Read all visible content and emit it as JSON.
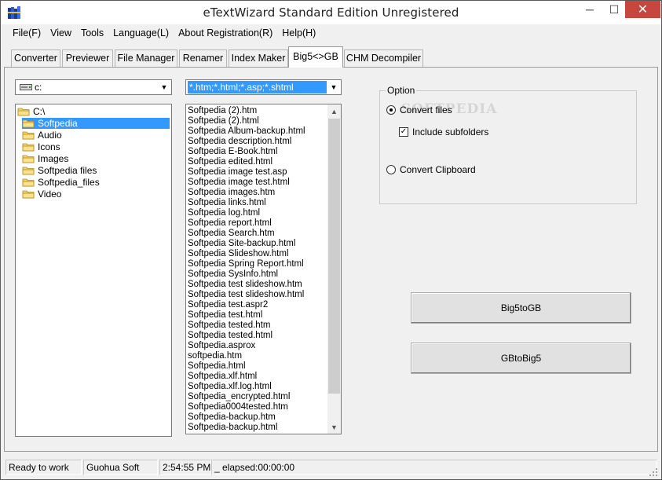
{
  "window": {
    "title": "eTextWizard Standard Edition Unregistered",
    "controls": {
      "minimize": "─",
      "maximize": "☐",
      "close": "✕"
    }
  },
  "menu": [
    "File(F)",
    "View",
    "Tools",
    "Language(L)",
    "About Registration(R)",
    "Help(H)"
  ],
  "tabs": [
    {
      "label": "Converter",
      "active": false
    },
    {
      "label": "Previewer",
      "active": false
    },
    {
      "label": "File Manager",
      "active": false
    },
    {
      "label": "Renamer",
      "active": false
    },
    {
      "label": "Index Maker",
      "active": false
    },
    {
      "label": "Big5<>GB",
      "active": true
    },
    {
      "label": "CHM Decompiler",
      "active": false
    }
  ],
  "drive_select": {
    "value": "c:"
  },
  "filter_select": {
    "value": "*.htm;*.html;*.asp;*.shtml"
  },
  "folder_tree": [
    {
      "label": "C:\\",
      "level": 0,
      "selected": false
    },
    {
      "label": "Softpedia",
      "level": 1,
      "selected": true
    },
    {
      "label": "Audio",
      "level": 2,
      "selected": false
    },
    {
      "label": "Icons",
      "level": 2,
      "selected": false
    },
    {
      "label": "Images",
      "level": 2,
      "selected": false
    },
    {
      "label": "Softpedia files",
      "level": 2,
      "selected": false
    },
    {
      "label": "Softpedia_files",
      "level": 2,
      "selected": false
    },
    {
      "label": "Video",
      "level": 2,
      "selected": false
    }
  ],
  "files": [
    "Softpedia (2).htm",
    "Softpedia (2).html",
    "Softpedia Album-backup.html",
    "Softpedia description.html",
    "Softpedia E-Book.html",
    "Softpedia edited.html",
    "Softpedia image test.asp",
    "Softpedia image test.html",
    "Softpedia images.htm",
    "Softpedia links.html",
    "Softpedia log.html",
    "Softpedia report.html",
    "Softpedia Search.htm",
    "Softpedia Site-backup.html",
    "Softpedia Slideshow.html",
    "Softpedia Spring Report.html",
    "Softpedia SysInfo.html",
    "Softpedia test slideshow.htm",
    "Softpedia test slideshow.html",
    "Softpedia test.aspr2",
    "Softpedia test.html",
    "Softpedia tested.htm",
    "Softpedia tested.html",
    "Softpedia.asprox",
    "softpedia.htm",
    "Softpedia.html",
    "Softpedia.xlf.html",
    "Softpedia.xlf.log.html",
    "Softpedia_encrypted.html",
    "Softpedia0004tested.htm",
    "Softpedia-backup.htm",
    "Softpedia-backup.html"
  ],
  "option": {
    "group_label": "Option",
    "convert_files": {
      "label": "Convert files",
      "checked": true
    },
    "include_subfolders": {
      "label": "Include subfolders",
      "checked": true
    },
    "convert_clipboard": {
      "label": "Convert Clipboard",
      "checked": false
    }
  },
  "watermark": "SOFTPEDIA",
  "buttons": {
    "big5_to_gb": "Big5toGB",
    "gb_to_big5": "GBtoBig5"
  },
  "status": {
    "state": "Ready to work",
    "company": "Guohua Soft",
    "time": "2:54:55 PM",
    "elapsed": "_  elapsed:00:00:00"
  },
  "colors": {
    "selection": "#3399ff",
    "close_button": "#c7463d"
  },
  "icons": [
    "app-icon",
    "drive-icon",
    "folder-icon",
    "checkmark-icon",
    "chevron-down-icon",
    "resize-grip-icon"
  ]
}
